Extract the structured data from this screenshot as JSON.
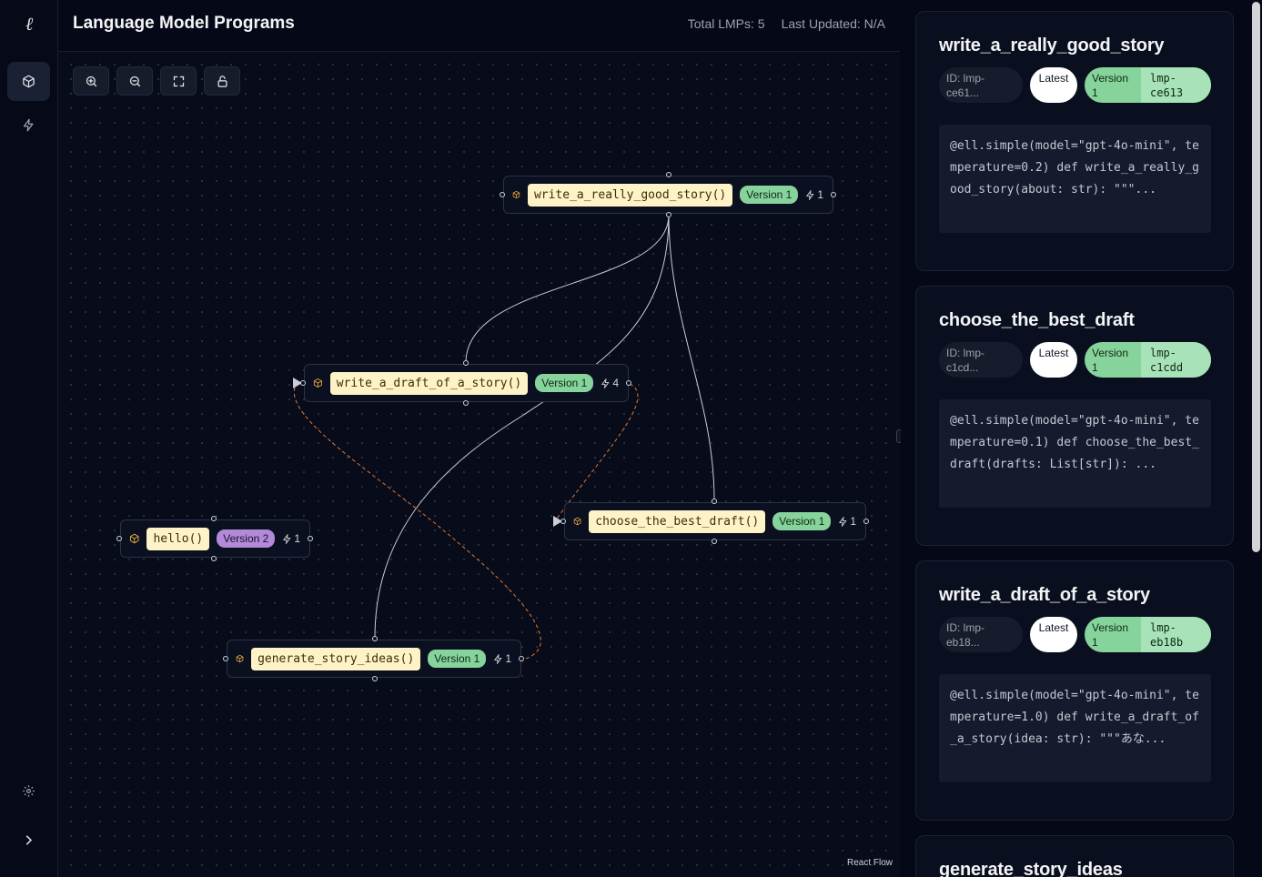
{
  "app": {
    "logo": "ℓ",
    "rail": [
      {
        "name": "lmp-nav",
        "icon": "cube-icon",
        "active": true
      },
      {
        "name": "invocations-nav",
        "icon": "bolt-icon",
        "active": false
      }
    ],
    "rail_bottom": [
      {
        "name": "settings",
        "icon": "gear-icon"
      },
      {
        "name": "expand",
        "icon": "chevron-right-icon"
      }
    ]
  },
  "header": {
    "title": "Language Model Programs",
    "total_lmps": "Total LMPs: 5",
    "last_updated": "Last Updated: N/A"
  },
  "toolbar": {
    "zoom_in": "zoom-in-icon",
    "zoom_out": "zoom-out-icon",
    "fit_view": "fit-view-icon",
    "lock": "unlock-icon"
  },
  "graph": {
    "nodes": [
      {
        "id": "n1",
        "fn": "write_a_really_good_story()",
        "version": "Version 1",
        "calls": "1",
        "color": "green"
      },
      {
        "id": "n2",
        "fn": "write_a_draft_of_a_story()",
        "version": "Version 1",
        "calls": "4",
        "color": "green"
      },
      {
        "id": "n3",
        "fn": "choose_the_best_draft()",
        "version": "Version 1",
        "calls": "1",
        "color": "green"
      },
      {
        "id": "n4",
        "fn": "hello()",
        "version": "Version 2",
        "calls": "1",
        "color": "purple"
      },
      {
        "id": "n5",
        "fn": "generate_story_ideas()",
        "version": "Version 1",
        "calls": "1",
        "color": "green"
      }
    ],
    "edge_colors": {
      "uses": "#c9ced8",
      "dataflow": "#e07a2f"
    },
    "attribution": "React Flow"
  },
  "panel": {
    "cards": [
      {
        "title": "write_a_really_good_story",
        "id": "ID: lmp-\nce61...",
        "latest": "Latest",
        "version": "Version\n1",
        "hash": "lmp-\nce613",
        "code": "@ell.simple(model=\"gpt-4o-mini\", temperature=0.2) def write_a_really_good_story(about: str): \"\"\"..."
      },
      {
        "title": "choose_the_best_draft",
        "id": "ID: lmp-\nc1cd...",
        "latest": "Latest",
        "version": "Version\n1",
        "hash": "lmp-\nc1cdd",
        "code": "@ell.simple(model=\"gpt-4o-mini\", temperature=0.1) def choose_the_best_draft(drafts: List[str]): ..."
      },
      {
        "title": "write_a_draft_of_a_story",
        "id": "ID: lmp-\neb18...",
        "latest": "Latest",
        "version": "Version\n1",
        "hash": "lmp-\neb18b",
        "code": "@ell.simple(model=\"gpt-4o-mini\", temperature=1.0) def write_a_draft_of_a_story(idea: str): \"\"\"あな..."
      },
      {
        "title": "generate_story_ideas"
      }
    ]
  }
}
